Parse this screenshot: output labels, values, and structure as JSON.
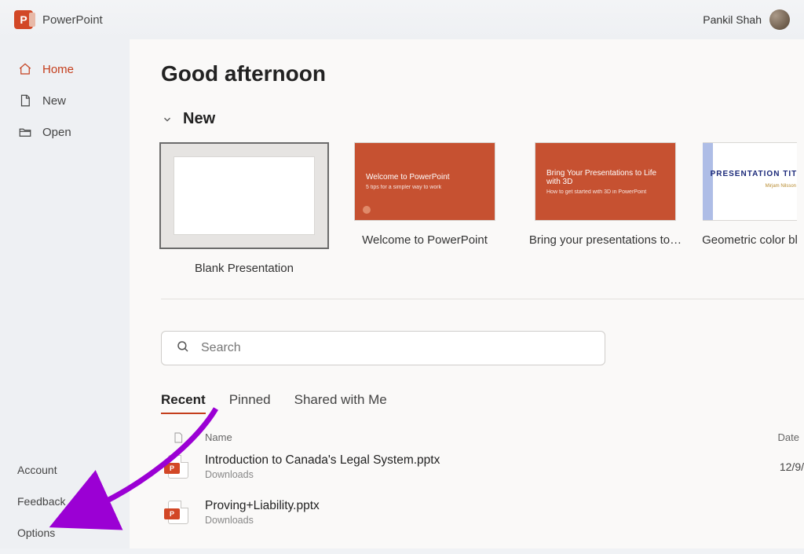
{
  "app": {
    "title": "PowerPoint",
    "icon_letter": "P"
  },
  "user": {
    "name": "Pankil Shah"
  },
  "sidebar": {
    "nav": [
      {
        "label": "Home"
      },
      {
        "label": "New"
      },
      {
        "label": "Open"
      }
    ],
    "bottom": [
      {
        "label": "Account"
      },
      {
        "label": "Feedback"
      },
      {
        "label": "Options"
      }
    ]
  },
  "main": {
    "greeting": "Good afternoon",
    "new_section": "New",
    "templates": [
      {
        "label": "Blank Presentation",
        "thumb_line1": "",
        "thumb_line2": ""
      },
      {
        "label": "Welcome to PowerPoint",
        "thumb_line1": "Welcome to PowerPoint",
        "thumb_line2": "5 tips for a simpler way to work"
      },
      {
        "label": "Bring your presentations to…",
        "thumb_line1": "Bring Your Presentations to Life with 3D",
        "thumb_line2": "How to get started with 3D in PowerPoint"
      },
      {
        "label": "Geometric color bl",
        "thumb_line1": "PRESENTATION TITLE",
        "thumb_line2": "Mirjam Nilsson"
      }
    ],
    "search_placeholder": "Search",
    "tabs": [
      {
        "label": "Recent"
      },
      {
        "label": "Pinned"
      },
      {
        "label": "Shared with Me"
      }
    ],
    "columns": {
      "name": "Name",
      "date": "Date"
    },
    "files": [
      {
        "name": "Introduction to Canada's Legal System.pptx",
        "location": "Downloads",
        "date": "12/9/"
      },
      {
        "name": "Proving+Liability.pptx",
        "location": "Downloads",
        "date": ""
      }
    ]
  }
}
